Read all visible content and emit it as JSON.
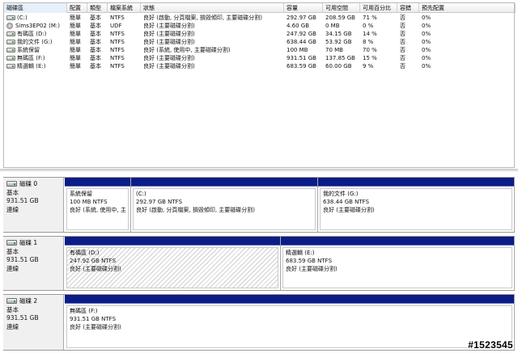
{
  "columns": [
    "磁碟區",
    "配置",
    "類型",
    "檔案系統",
    "狀態",
    "容量",
    "可用空間",
    "可用百分比",
    "容錯",
    "預先配置"
  ],
  "volumes": [
    {
      "name": "(C:)",
      "icon": "hard-drive-icon",
      "layout": "簡單",
      "type": "基本",
      "fs": "NTFS",
      "status": "良好 (啟動, 分頁檔案, 損毀傾印, 主要磁碟分割)",
      "capacity": "292.97 GB",
      "free": "208.59 GB",
      "pct": "71 %",
      "fault": "否",
      "overhead": "0%"
    },
    {
      "name": "Sims3EP02 (M:)",
      "icon": "cd-rom-icon",
      "layout": "簡單",
      "type": "基本",
      "fs": "UDF",
      "status": "良好 (主要磁碟分割)",
      "capacity": "4.60 GB",
      "free": "0 MB",
      "pct": "0 %",
      "fault": "否",
      "overhead": "0%"
    },
    {
      "name": "有碼區 (D:)",
      "icon": "hard-drive-icon",
      "layout": "簡單",
      "type": "基本",
      "fs": "NTFS",
      "status": "良好 (主要磁碟分割)",
      "capacity": "247.92 GB",
      "free": "34.15 GB",
      "pct": "14 %",
      "fault": "否",
      "overhead": "0%"
    },
    {
      "name": "我的文件 (G:)",
      "icon": "hard-drive-icon",
      "layout": "簡單",
      "type": "基本",
      "fs": "NTFS",
      "status": "良好 (主要磁碟分割)",
      "capacity": "638.44 GB",
      "free": "53.92 GB",
      "pct": "8 %",
      "fault": "否",
      "overhead": "0%"
    },
    {
      "name": "系統保留",
      "icon": "hard-drive-icon",
      "layout": "簡單",
      "type": "基本",
      "fs": "NTFS",
      "status": "良好 (系統, 使用中, 主要磁碟分割)",
      "capacity": "100 MB",
      "free": "70 MB",
      "pct": "70 %",
      "fault": "否",
      "overhead": "0%"
    },
    {
      "name": "無碼區 (F:)",
      "icon": "hard-drive-icon",
      "layout": "簡單",
      "type": "基本",
      "fs": "NTFS",
      "status": "良好 (主要磁碟分割)",
      "capacity": "931.51 GB",
      "free": "137.85 GB",
      "pct": "15 %",
      "fault": "否",
      "overhead": "0%"
    },
    {
      "name": "精選輯 (E:)",
      "icon": "hard-drive-icon",
      "layout": "簡單",
      "type": "基本",
      "fs": "NTFS",
      "status": "良好 (主要磁碟分割)",
      "capacity": "683.59 GB",
      "free": "60.00 GB",
      "pct": "9 %",
      "fault": "否",
      "overhead": "0%"
    }
  ],
  "disks": [
    {
      "name": "磁碟 0",
      "type": "基本",
      "size": "931.51 GB",
      "state": "連線",
      "partitions": [
        {
          "label": "系統保留",
          "size": "100 MB NTFS",
          "status": "良好 (系統, 使用中, 主"
        },
        {
          "label": "(C:)",
          "size": "292.97 GB NTFS",
          "status": "良好 (啟動, 分頁檔案, 損毀傾印, 主要磁碟分割)"
        },
        {
          "label": "我的文件  (G:)",
          "size": "638.44 GB NTFS",
          "status": "良好 (主要磁碟分割)"
        }
      ]
    },
    {
      "name": "磁碟 1",
      "type": "基本",
      "size": "931.51 GB",
      "state": "連線",
      "partitions": [
        {
          "label": "有碼區  (D:)",
          "size": "247.92 GB NTFS",
          "status": "良好 (主要磁碟分割)",
          "selected": true
        },
        {
          "label": "精選輯  (E:)",
          "size": "683.59 GB NTFS",
          "status": "良好 (主要磁碟分割)"
        }
      ]
    },
    {
      "name": "磁碟 2",
      "type": "基本",
      "size": "931.51 GB",
      "state": "連線",
      "partitions": [
        {
          "label": "無碼區  (F:)",
          "size": "931.51 GB NTFS",
          "status": "良好 (主要磁碟分割)"
        }
      ]
    }
  ],
  "watermark": "#1523545",
  "colors": {
    "partition_bar": "#0b1c87",
    "sorted_header": "#e6f0fa"
  }
}
